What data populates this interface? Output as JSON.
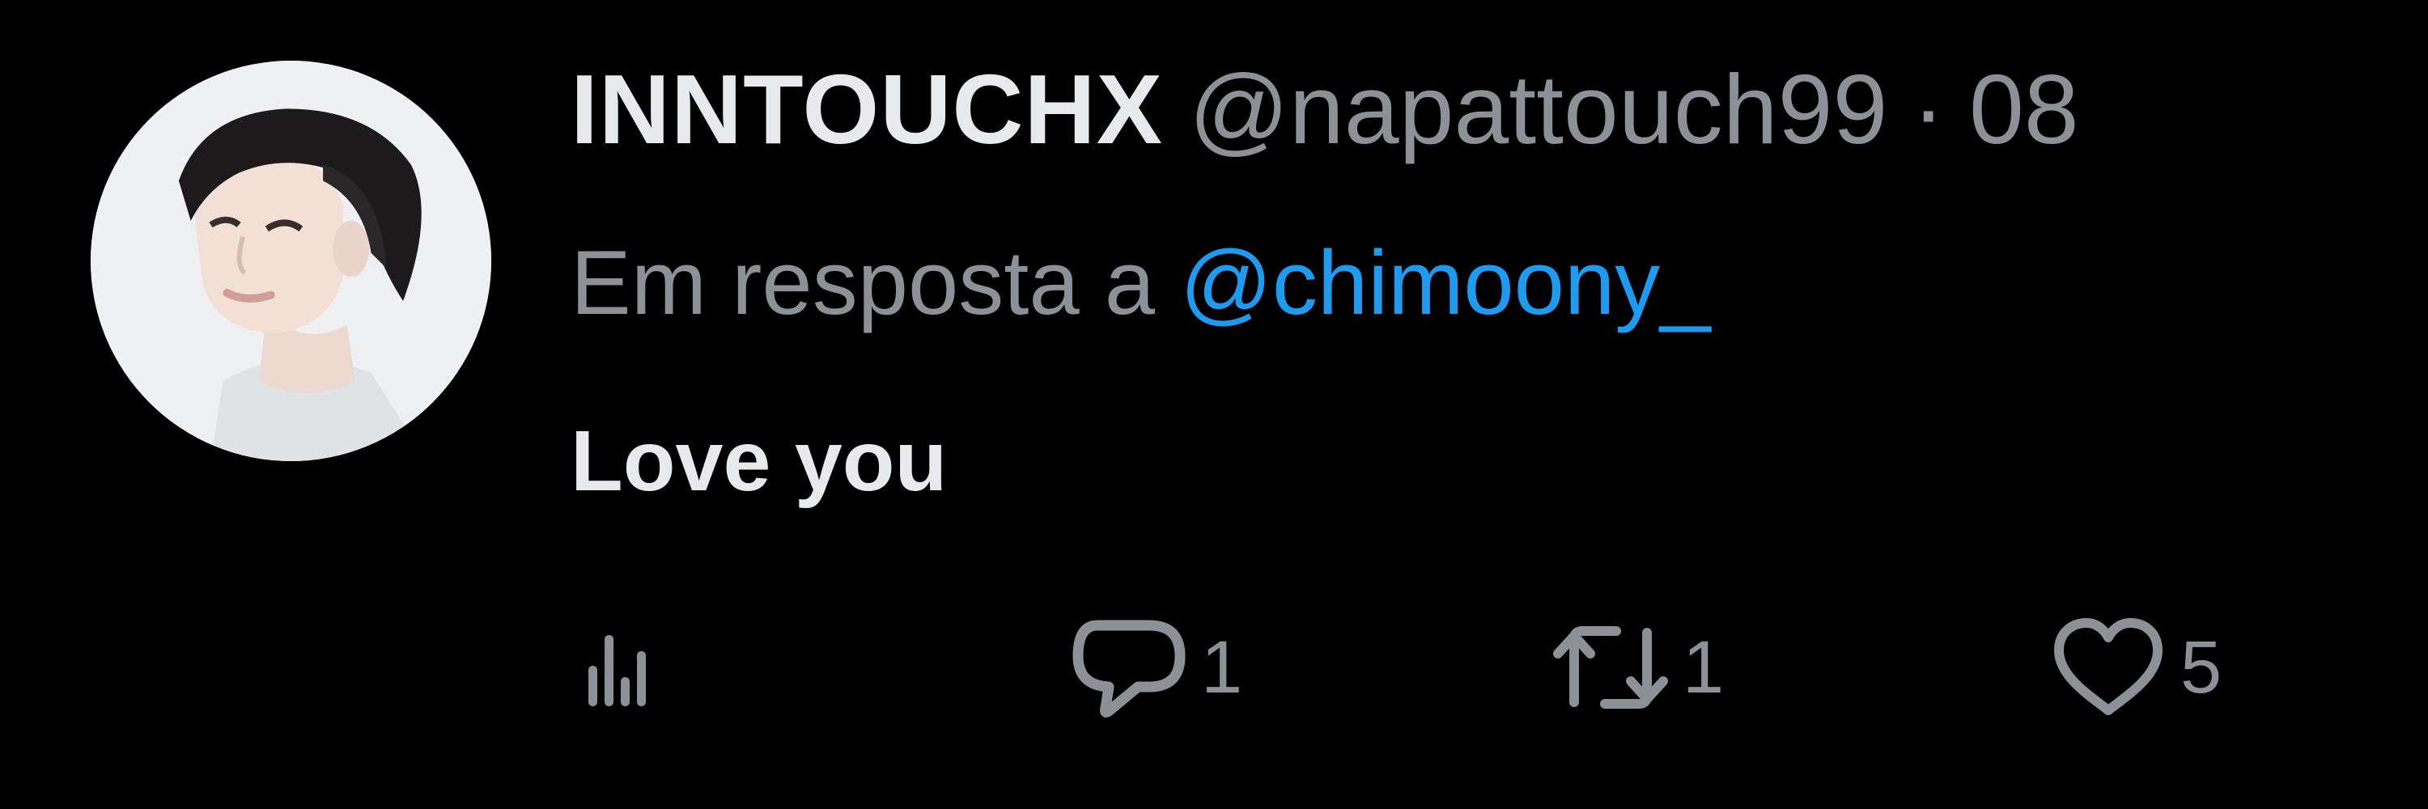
{
  "tweet": {
    "author": {
      "display_name": "INNTOUCHX",
      "handle": "@napattouch99",
      "avatar_icon": "profile-photo"
    },
    "separator": "·",
    "time": "08",
    "reply": {
      "prefix": "Em resposta a",
      "to": "@chimoony_"
    },
    "text": "Love you",
    "actions": {
      "views_icon": "bar-chart-icon",
      "reply_icon": "speech-bubble-icon",
      "reply_count": "1",
      "retweet_icon": "retweet-icon",
      "retweet_count": "1",
      "like_icon": "heart-icon",
      "like_count": "5"
    }
  },
  "colors": {
    "background": "#000000",
    "primary_text": "#e7e9ea",
    "secondary_text": "#8b9196",
    "accent_link": "#1d9bf0"
  }
}
